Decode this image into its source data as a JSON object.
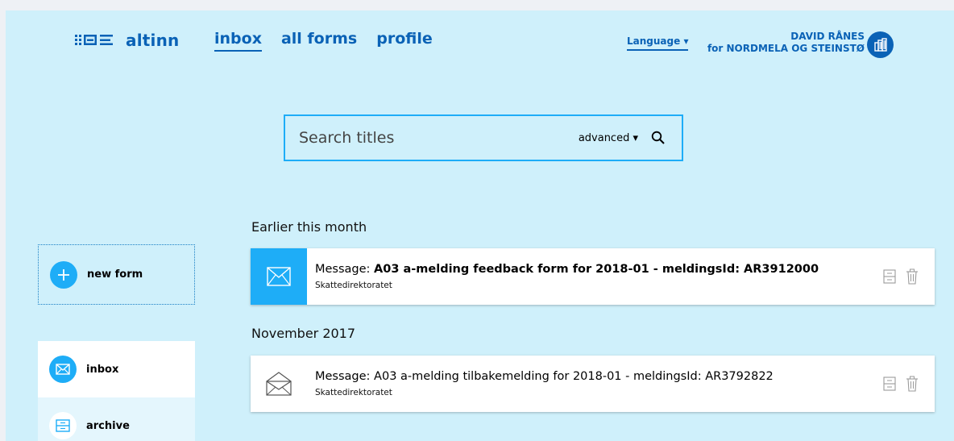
{
  "header": {
    "logo_text": "altinn",
    "nav": [
      {
        "label": "inbox",
        "active": true
      },
      {
        "label": "all forms",
        "active": false
      },
      {
        "label": "profile",
        "active": false
      }
    ],
    "language_label": "Language",
    "user_name": "DAVID RÅNES",
    "user_org": "for NORDMELA OG STEINSTØ"
  },
  "search": {
    "placeholder": "Search titles",
    "advanced_label": "advanced ▾"
  },
  "sidebar": {
    "new_form_label": "new form",
    "items": [
      {
        "label": "inbox",
        "icon": "envelope-icon",
        "active": true
      },
      {
        "label": "archive",
        "icon": "archive-icon",
        "active": false
      }
    ]
  },
  "inbox": {
    "groups": [
      {
        "title": "Earlier this month",
        "messages": [
          {
            "prefix": "Message: ",
            "subject": "A03 a-melding feedback form for 2018-01 - meldingsId: AR3912000",
            "sender": "Skattedirektoratet",
            "unread": true
          }
        ]
      },
      {
        "title": "November 2017",
        "messages": [
          {
            "prefix": "Message: ",
            "subject": "A03 a-melding tilbakemelding for 2018-01 - meldingsId: AR3792822",
            "sender": "Skattedirektoratet",
            "unread": false
          }
        ]
      }
    ]
  },
  "colors": {
    "background": "#cff0fb",
    "brand_blue": "#0a62b6",
    "accent_blue": "#1eadf7"
  }
}
